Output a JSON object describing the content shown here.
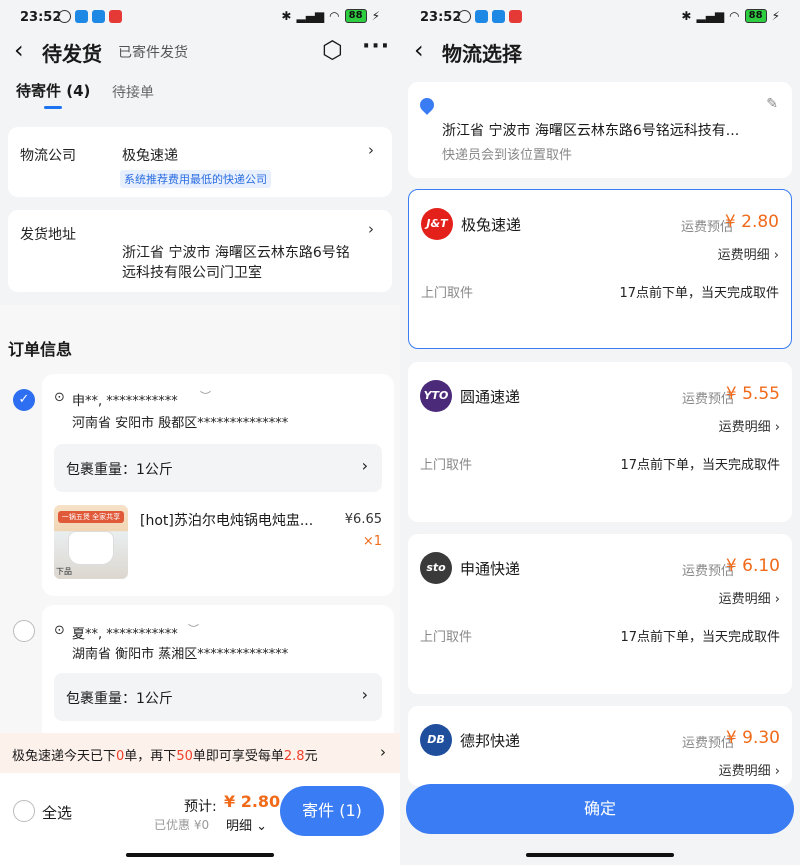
{
  "status": {
    "time": "23:52",
    "battery": "88",
    "carrier_mark": "HD"
  },
  "left": {
    "title": "待发货",
    "subtitle": "已寄件发货",
    "tabs": {
      "active": "待寄件 (4)",
      "inactive": "待接单"
    },
    "logistics": {
      "label": "物流公司",
      "value": "极兔速递",
      "hint": "系统推荐费用最低的快递公司"
    },
    "address": {
      "label": "发货地址",
      "line1": "浙江省 宁波市 海曙区云林东路6号铭",
      "line2": "远科技有限公司门卫室"
    },
    "order_section_title": "订单信息",
    "orders": [
      {
        "checked": true,
        "name": "申**, ***********",
        "address": "河南省 安阳市 殷都区**************",
        "weight": "包裹重量：1公斤",
        "product_title": "[hot]苏泊尔电炖锅电炖盅...",
        "price": "¥6.65",
        "qty": "×1",
        "thumb_top": "一锅五煲 全家共享",
        "thumb_bottom": "下品"
      },
      {
        "checked": false,
        "name": "夏**, ***********",
        "address": "湖南省 衡阳市 蒸湘区**************",
        "weight": "包裹重量：1公斤"
      }
    ],
    "notice": {
      "part1": "极兔速递今天已下",
      "n1": "0",
      "part2": "单，再下",
      "n2": "50",
      "part3": "单即可享受每单",
      "n3": "2.8",
      "part4": "元"
    },
    "bottom": {
      "select_all": "全选",
      "estimate_label": "预计:",
      "estimate_value": "¥ 2.80",
      "discount": "已优惠 ¥0",
      "detail": "明细",
      "submit": "寄件 (1)"
    }
  },
  "right": {
    "title": "物流选择",
    "address": {
      "line": "浙江省 宁波市 海曙区云林东路6号铭远科技有...",
      "note": "快递员会到该位置取件"
    },
    "fee_label": "运费预估",
    "detail_label": "运费明细",
    "pickup_label": "上门取件",
    "pickup_note": "17点前下单，当天完成取件",
    "carriers": [
      {
        "name": "极兔速递",
        "logo": "J&T",
        "fee": "¥ 2.80",
        "color": "#e4201a",
        "selected": true
      },
      {
        "name": "圆通速递",
        "logo": "YTO",
        "fee": "¥ 5.55",
        "color": "#4b2a7a",
        "selected": false
      },
      {
        "name": "申通快递",
        "logo": "sto",
        "fee": "¥ 6.10",
        "color": "#3a3a3a",
        "selected": false
      },
      {
        "name": "德邦快递",
        "logo": "DB",
        "fee": "¥ 9.30",
        "color": "#1f4e9c",
        "selected": false
      }
    ],
    "confirm": "确定"
  }
}
